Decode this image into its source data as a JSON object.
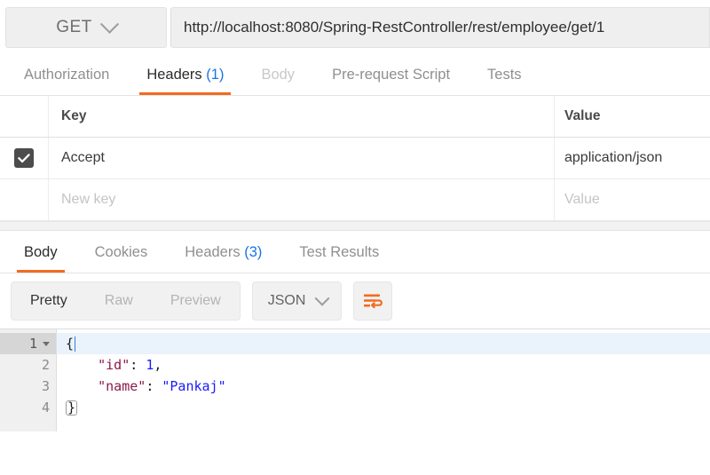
{
  "request": {
    "method": "GET",
    "method_icon": "chevron-down-icon",
    "url": "http://localhost:8080/Spring-RestController/rest/employee/get/1",
    "tabs": [
      {
        "label": "Authorization",
        "state": "normal"
      },
      {
        "label": "Headers",
        "count": "(1)",
        "state": "active"
      },
      {
        "label": "Body",
        "state": "dim"
      },
      {
        "label": "Pre-request Script",
        "state": "normal"
      },
      {
        "label": "Tests",
        "state": "normal"
      }
    ]
  },
  "headers_table": {
    "columns": {
      "key": "Key",
      "value": "Value"
    },
    "rows": [
      {
        "checked": true,
        "key": "Accept",
        "value": "application/json"
      }
    ],
    "new_row": {
      "key_placeholder": "New key",
      "value_placeholder": "Value"
    }
  },
  "response": {
    "tabs": [
      {
        "label": "Body",
        "state": "active"
      },
      {
        "label": "Cookies",
        "state": "normal"
      },
      {
        "label": "Headers",
        "count": "(3)",
        "state": "normal"
      },
      {
        "label": "Test Results",
        "state": "normal"
      }
    ],
    "format_modes": [
      {
        "label": "Pretty",
        "state": "active"
      },
      {
        "label": "Raw",
        "state": "normal"
      },
      {
        "label": "Preview",
        "state": "normal"
      }
    ],
    "language": "JSON",
    "language_icon": "chevron-down-icon",
    "wrap_icon": "word-wrap-icon",
    "body_lines": [
      {
        "number": "1",
        "folded": true,
        "highlighted": true
      },
      {
        "number": "2",
        "folded": false,
        "highlighted": false
      },
      {
        "number": "3",
        "folded": false,
        "highlighted": false
      },
      {
        "number": "4",
        "folded": false,
        "highlighted": false
      }
    ],
    "body_json": {
      "open_brace": "{",
      "close_brace": "}",
      "id_key": "\"id\"",
      "id_colon": ": ",
      "id_value": "1",
      "id_comma": ",",
      "name_key": "\"name\"",
      "name_colon": ": ",
      "name_value": "\"Pankaj\""
    }
  },
  "colors": {
    "accent": "#f26b21",
    "link": "#1a73e8",
    "json_key": "#8b1a4b",
    "json_value": "#1a1aff",
    "checkbox": "#4c4c4c"
  }
}
